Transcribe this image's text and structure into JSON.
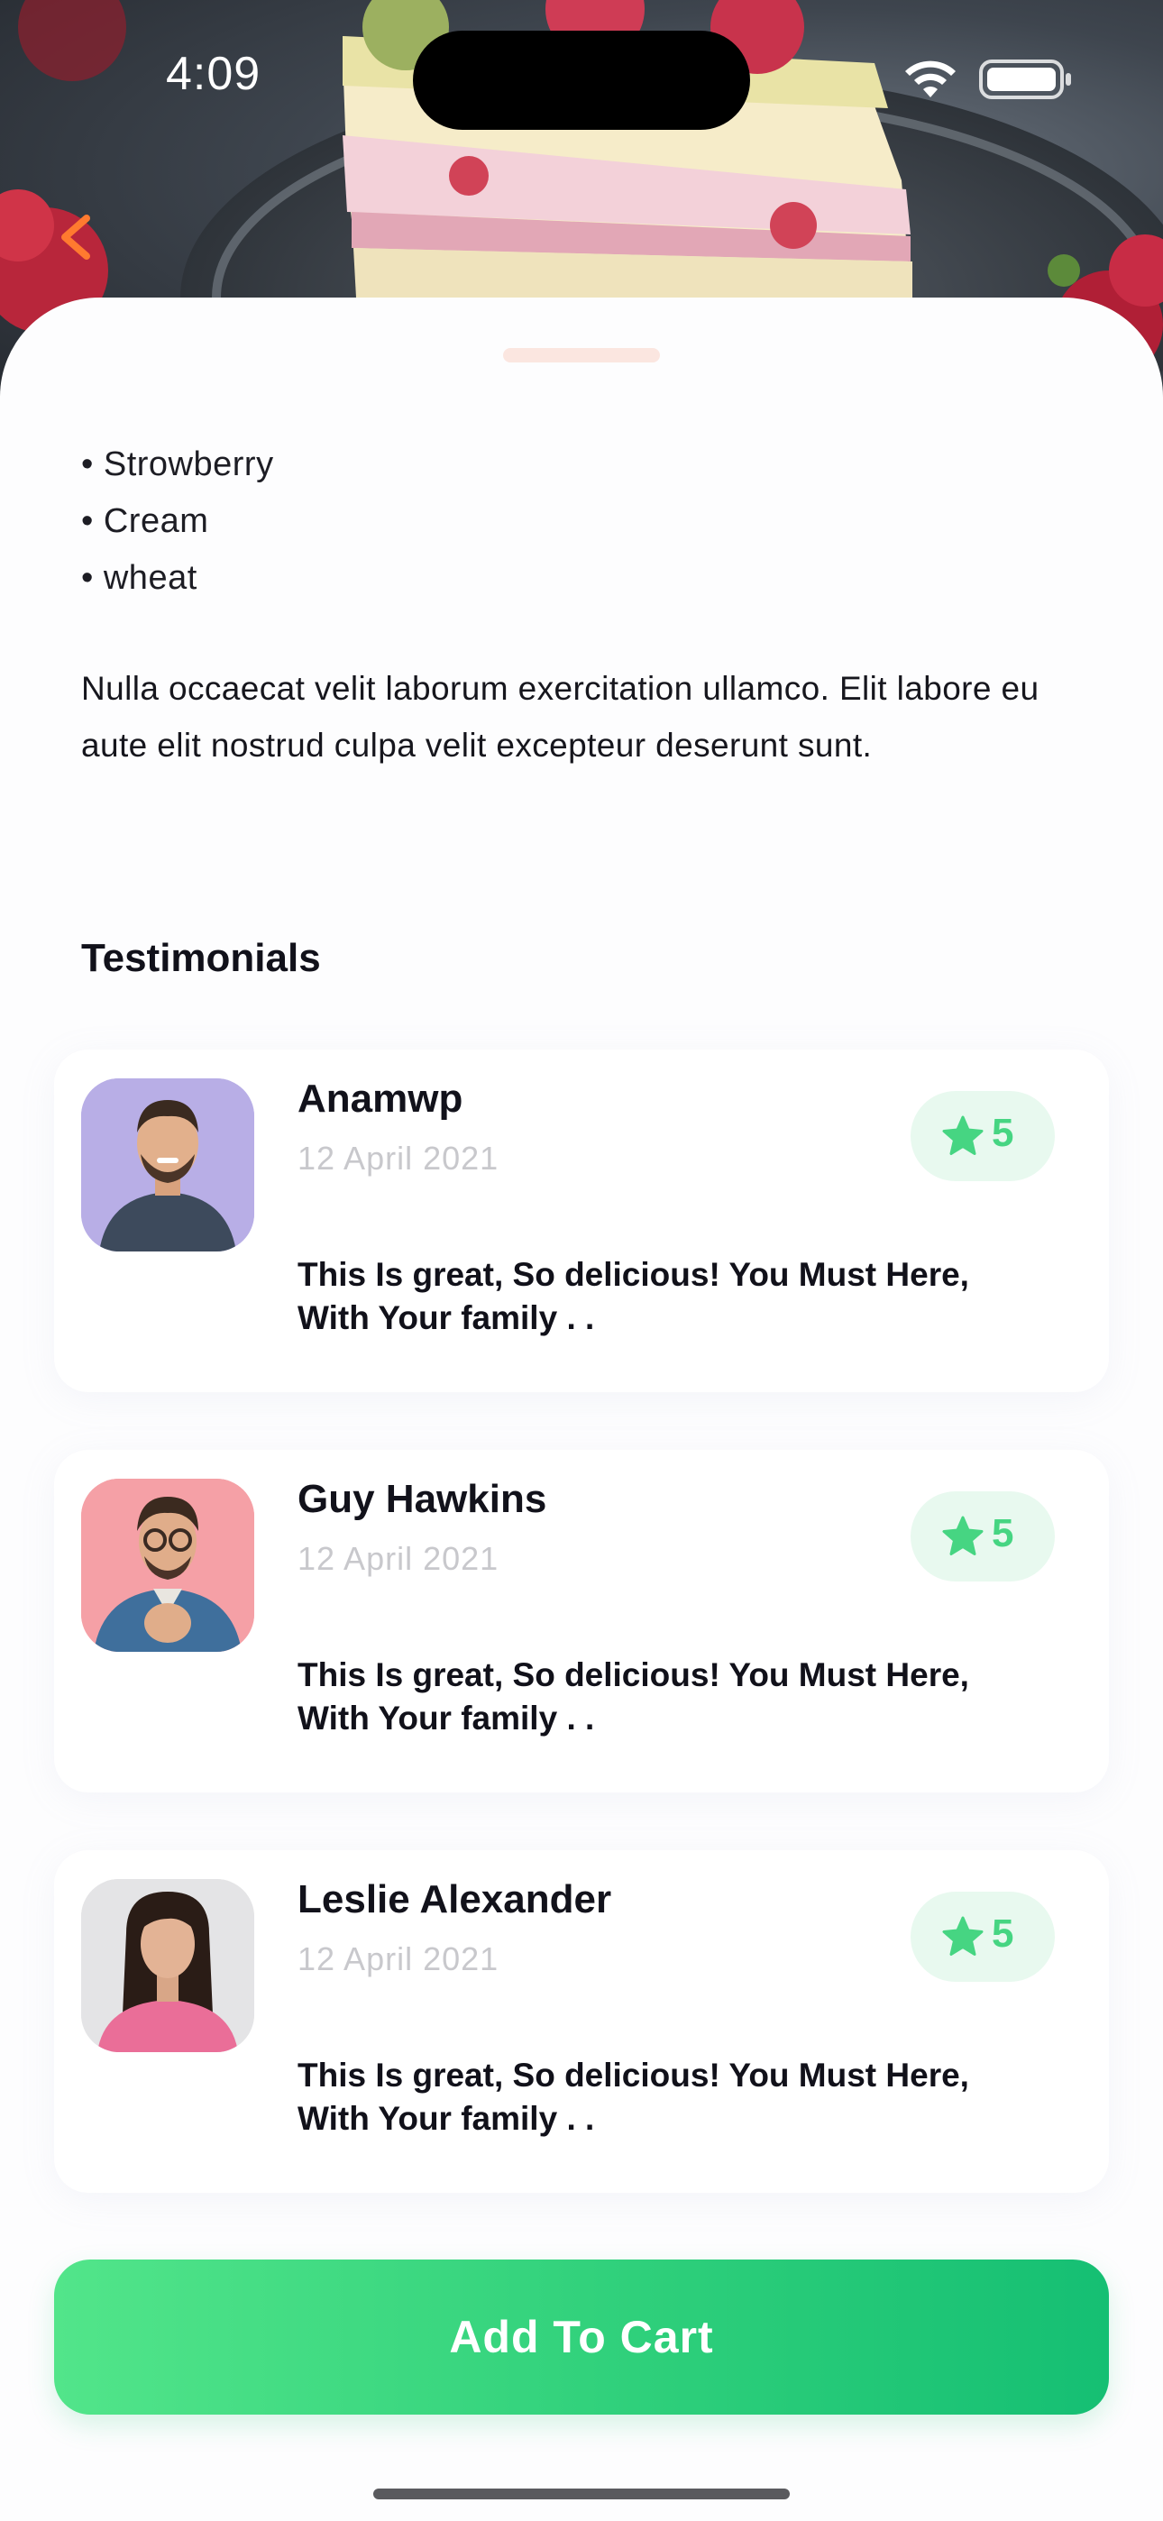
{
  "status_bar": {
    "time": "4:09"
  },
  "ingredients": [
    "• Strowberry",
    "• Cream",
    "• wheat"
  ],
  "description": "Nulla occaecat velit laborum exercitation ullamco. Elit labore eu aute elit nostrud culpa velit excepteur deserunt sunt.",
  "testimonials": {
    "title": "Testimonials",
    "items": [
      {
        "name": "Anamwp",
        "date": "12 April 2021",
        "rating": "5",
        "text": "This Is great, So delicious! You Must Here, With Your family . .",
        "avatar_bg": "#b8aee6"
      },
      {
        "name": "Guy Hawkins",
        "date": "12 April 2021",
        "rating": "5",
        "text": "This Is great, So delicious! You Must Here, With Your family . .",
        "avatar_bg": "#f5a0a6"
      },
      {
        "name": "Leslie Alexander",
        "date": "12 April 2021",
        "rating": "5",
        "text": "This Is great, So delicious! You Must Here, With Your family . .",
        "avatar_bg": "#e4e4e6"
      }
    ]
  },
  "cart_button": {
    "label": "Add To Cart"
  },
  "colors": {
    "accent_green": "#2fd07b",
    "back_arrow": "#ff7a2f",
    "rating_bg": "#e8f9ef"
  },
  "icons": [
    "chevron-left-icon",
    "wifi-icon",
    "battery-icon",
    "star-icon"
  ]
}
